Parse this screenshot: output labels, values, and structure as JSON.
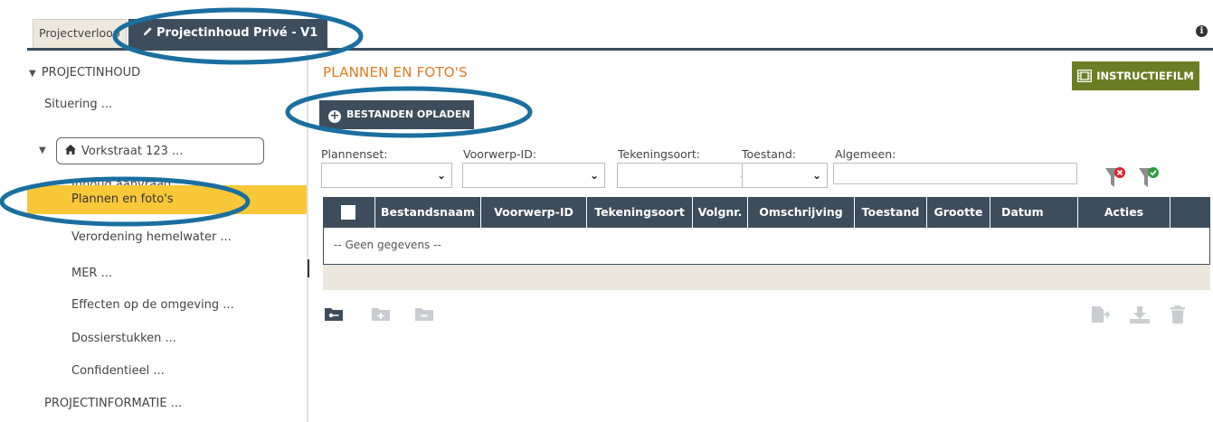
{
  "tabs": {
    "inactive_label": "Projectverloop",
    "active_label": "Projectinhoud Privé - V1",
    "info_icon": "info-icon"
  },
  "sidebar": {
    "section_header": "PROJECTINHOUD",
    "items": [
      {
        "label": "Situering ..."
      },
      {
        "label": "Vorkstraat 123 ..."
      },
      {
        "label": "Inhoud aanvraag"
      },
      {
        "label": "Plannen en foto's"
      },
      {
        "label": "Verordening hemelwater ..."
      },
      {
        "label": "MER ..."
      },
      {
        "label": "Effecten op de omgeving ..."
      },
      {
        "label": "Dossierstukken ..."
      },
      {
        "label": "Confidentieel ..."
      }
    ],
    "footer_section": "PROJECTINFORMATIE ...",
    "selected_color": "#f9c838"
  },
  "main": {
    "title": "PLANNEN EN FOTO'S",
    "instructiefilm_label": "INSTRUCTIEFILM",
    "upload_label": "BESTANDEN OPLADEN",
    "filters": {
      "plannenset_label": "Plannenset:",
      "voorwerp_label": "Voorwerp-ID:",
      "tekeningsoort_label": "Tekeningsoort:",
      "toestand_label": "Toestand:",
      "algemeen_label": "Algemeen:",
      "algemeen_value": ""
    },
    "table": {
      "columns": [
        "Bestandsnaam",
        "Voorwerp-ID",
        "Tekeningsoort",
        "Volgnr.",
        "Omschrijving",
        "Toestand",
        "Grootte",
        "Datum",
        "Acties"
      ],
      "empty_text": "-- Geen gegevens --"
    }
  },
  "colors": {
    "header_dark": "#3d4d5c",
    "accent_orange": "#e07b22",
    "film_green": "#6d7d25",
    "highlight_ring": "#1a6fa0"
  }
}
